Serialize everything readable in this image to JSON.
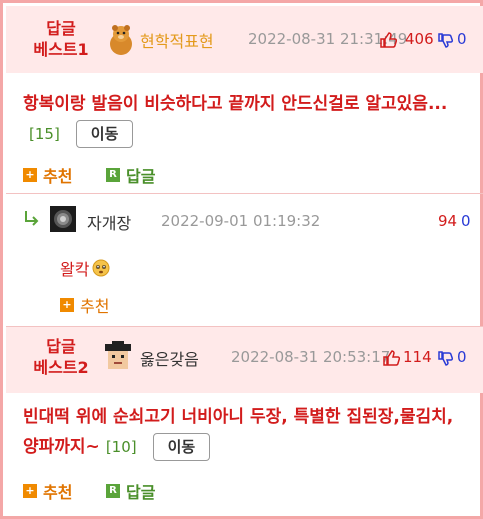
{
  "best1": {
    "label_line1": "답글",
    "label_line2": "베스트1",
    "nickname": "현학적표현",
    "date": "2022-08-31 21:31:49",
    "up": "406",
    "down": "0",
    "text": "항복이랑 발음이 비슷하다고 끝까지 안드신걸로 알고있음...",
    "replies": "[15]",
    "move_label": "이동",
    "recommend_label": "추천",
    "reply_label": "답글"
  },
  "reply1": {
    "nickname": "자개장",
    "date": "2022-09-01 01:19:32",
    "up": "94",
    "down": "0",
    "text": "왈칵",
    "recommend_label": "추천"
  },
  "best2": {
    "label_line1": "답글",
    "label_line2": "베스트2",
    "nickname": "옳은갖음",
    "date": "2022-08-31 20:53:17",
    "up": "114",
    "down": "0",
    "text": "빈대떡 위에 순쇠고기 너비아니 두장, 특별한 집된장,물김치, 양파까지~",
    "replies": "[10]",
    "move_label": "이동",
    "recommend_label": "추천",
    "reply_label": "답글"
  },
  "colors": {
    "accent_red": "#d21c1c",
    "header_bg": "#ffe9e9",
    "border": "#f4a7a7",
    "recommend": "#e07400",
    "reply": "#4a8f2a",
    "down_blue": "#2a3bd6"
  },
  "icons": [
    "thumbs-up-icon",
    "thumbs-down-icon",
    "reply-arrow-icon",
    "plus-square-icon",
    "r-square-icon",
    "sweat-emoji-icon"
  ]
}
